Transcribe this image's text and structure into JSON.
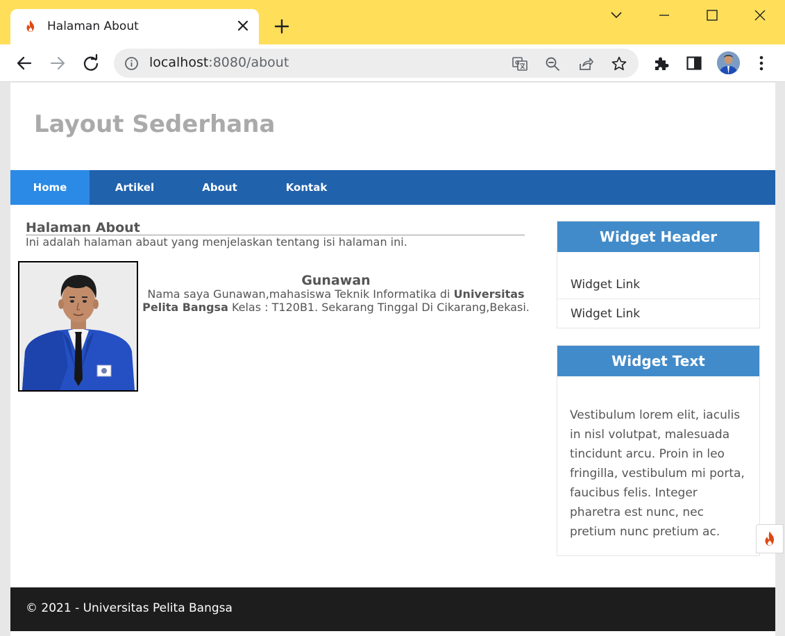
{
  "browser": {
    "tab_title": "Halaman About",
    "url_host": "localhost",
    "url_rest": ":8080/about",
    "accent_color": "#ffde59"
  },
  "site": {
    "title": "Layout Sederhana",
    "nav": [
      "Home",
      "Artikel",
      "About",
      "Kontak"
    ],
    "nav_active": "Home"
  },
  "main": {
    "title": "Halaman About",
    "description": "Ini adalah halaman abaut yang menjelaskan tentang isi halaman ini.",
    "bio_name": "Gunawan",
    "bio_text_1": "Nama saya Gunawan,mahasiswa Teknik Informatika di ",
    "bio_bold_1": "Universitas Pelita Bangsa",
    "bio_text_2": " Kelas : T120B1. Sekarang Tinggal Di Cikarang,Bekasi."
  },
  "sidebar": {
    "widget1": {
      "header": "Widget Header",
      "links": [
        "Widget Link",
        "Widget Link"
      ]
    },
    "widget2": {
      "header": "Widget Text",
      "body": "Vestibulum lorem elit, iaculis in nisl volutpat, malesuada tincidunt arcu. Proin in leo fringilla, vestibulum mi porta, faucibus felis. Integer pharetra est nunc, nec pretium nunc pretium ac."
    }
  },
  "footer": {
    "text": "© 2021 - Universitas Pelita Bangsa"
  },
  "colors": {
    "nav_bg": "#2162ad",
    "nav_active": "#2b8ae5",
    "widget_header": "#428bca",
    "footer_bg": "#1d1d1d"
  }
}
